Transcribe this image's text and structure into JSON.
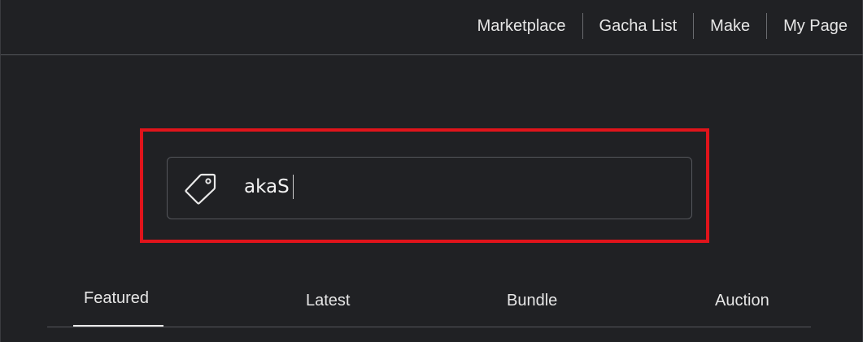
{
  "nav": {
    "items": [
      {
        "label": "Marketplace"
      },
      {
        "label": "Gacha List"
      },
      {
        "label": "Make"
      },
      {
        "label": "My Page"
      }
    ]
  },
  "tag_input": {
    "icon": "tag-icon",
    "value": "akaS"
  },
  "tabs": {
    "items": [
      {
        "label": "Featured",
        "active": true
      },
      {
        "label": "Latest",
        "active": false
      },
      {
        "label": "Bundle",
        "active": false
      },
      {
        "label": "Auction",
        "active": false
      }
    ]
  },
  "colors": {
    "background": "#202124",
    "text": "#e6e6e6",
    "border": "#55575c",
    "highlight": "#e0141b"
  }
}
